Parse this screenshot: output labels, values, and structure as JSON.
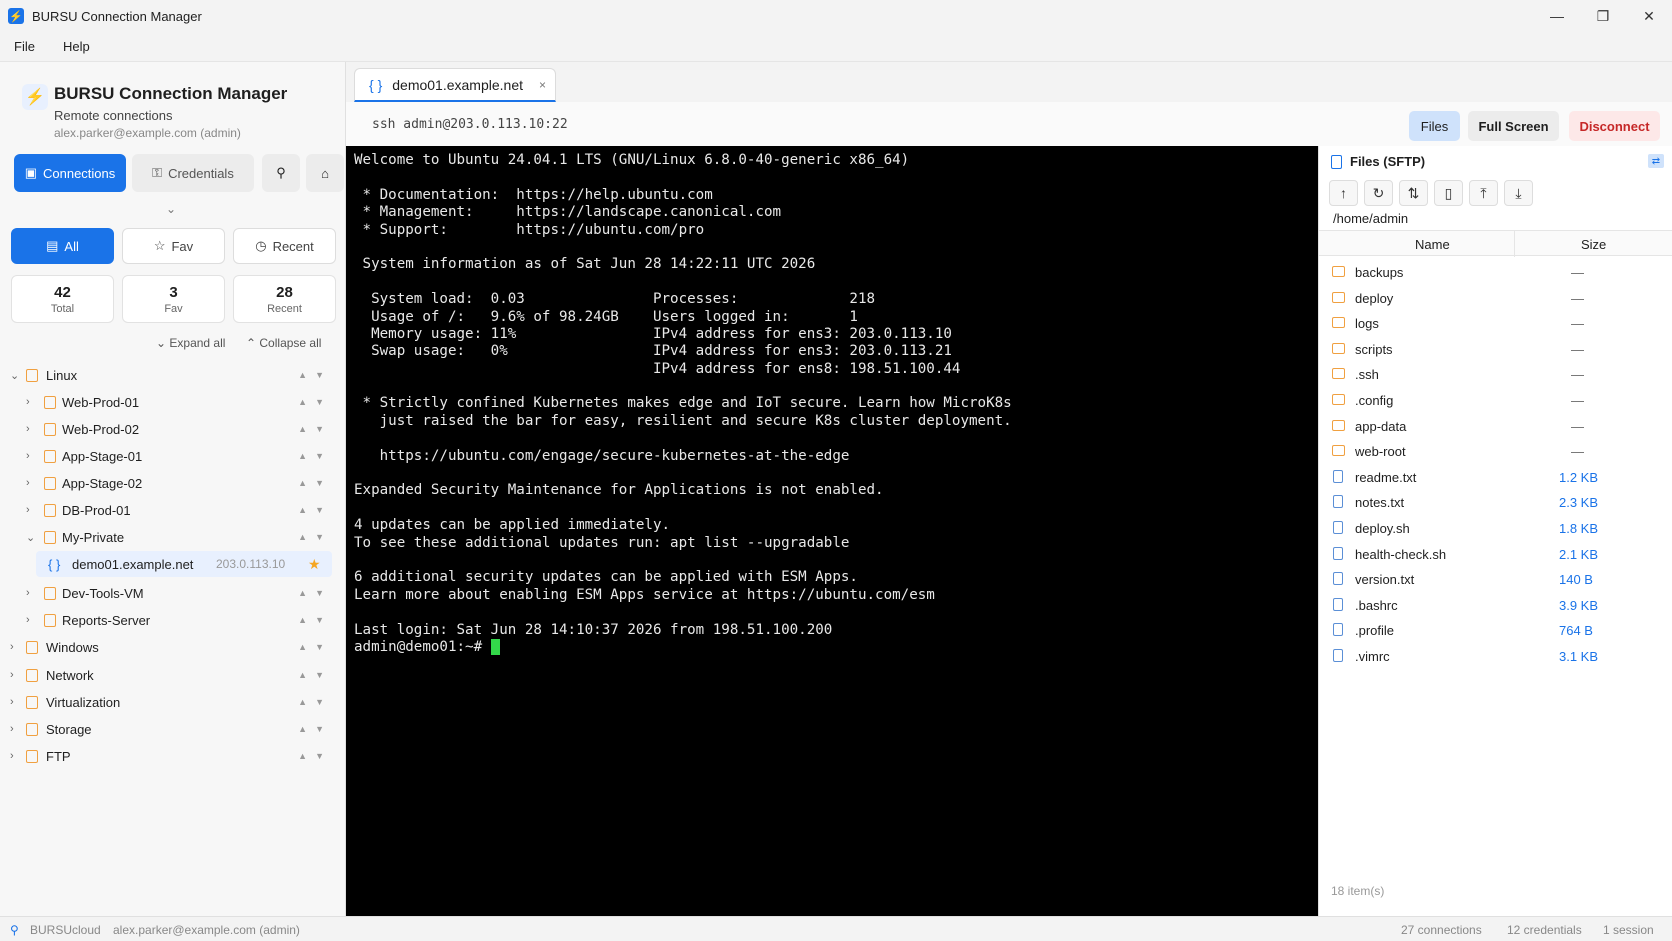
{
  "window": {
    "title": "BURSU Connection Manager",
    "min": "—",
    "max": "❐",
    "close": "✕",
    "logo": "⚡"
  },
  "menu": [
    "File",
    "Help"
  ],
  "sidebar": {
    "brand": {
      "name": "BURSU Connection Manager",
      "subtitle": "Remote connections",
      "user": "alex.parker@example.com (admin)",
      "icon": "⚡"
    },
    "nav": {
      "connections": "Connections",
      "credentials": "Credentials"
    },
    "filters": {
      "all": "All",
      "fav": "Fav",
      "recent": "Recent"
    },
    "stats": [
      {
        "value": "42",
        "label": "Total"
      },
      {
        "value": "3",
        "label": "Fav"
      },
      {
        "value": "28",
        "label": "Recent"
      }
    ],
    "expand_all": "Expand all",
    "collapse_all": "Collapse all",
    "tree": [
      {
        "label": "Linux",
        "level": 0,
        "expanded": true
      },
      {
        "label": "Web-Prod-01",
        "level": 1,
        "expanded": false
      },
      {
        "label": "Web-Prod-02",
        "level": 1,
        "expanded": false
      },
      {
        "label": "App-Stage-01",
        "level": 1,
        "expanded": false
      },
      {
        "label": "App-Stage-02",
        "level": 1,
        "expanded": false
      },
      {
        "label": "DB-Prod-01",
        "level": 1,
        "expanded": false
      },
      {
        "label": "My-Private",
        "level": 1,
        "expanded": true
      },
      {
        "label": "demo01.example.net",
        "level": 2,
        "selected": true,
        "ip": "203.0.113.10"
      },
      {
        "label": "Dev-Tools-VM",
        "level": 1,
        "expanded": false
      },
      {
        "label": "Reports-Server",
        "level": 1,
        "expanded": false
      },
      {
        "label": "Windows",
        "level": 0,
        "expanded": false
      },
      {
        "label": "Network",
        "level": 0,
        "expanded": false
      },
      {
        "label": "Virtualization",
        "level": 0,
        "expanded": false
      },
      {
        "label": "Storage",
        "level": 0,
        "expanded": false
      },
      {
        "label": "FTP",
        "level": 0,
        "expanded": false
      }
    ]
  },
  "tab": {
    "label": "demo01.example.net",
    "icon": "{ }",
    "close": "×"
  },
  "toolbar": {
    "ssh": "ssh  admin@203.0.113.10:22",
    "files": "Files",
    "full_screen": "Full Screen",
    "disconnect": "Disconnect"
  },
  "terminal": {
    "lines": [
      "Welcome to Ubuntu 24.04.1 LTS (GNU/Linux 6.8.0-40-generic x86_64)",
      "",
      " * Documentation:  https://help.ubuntu.com",
      " * Management:     https://landscape.canonical.com",
      " * Support:        https://ubuntu.com/pro",
      "",
      " System information as of Sat Jun 28 14:22:11 UTC 2026",
      "",
      "  System load:  0.03               Processes:             218",
      "  Usage of /:   9.6% of 98.24GB    Users logged in:       1",
      "  Memory usage: 11%                IPv4 address for ens3: 203.0.113.10",
      "  Swap usage:   0%                 IPv4 address for ens3: 203.0.113.21",
      "                                   IPv4 address for ens8: 198.51.100.44",
      "",
      " * Strictly confined Kubernetes makes edge and IoT secure. Learn how MicroK8s",
      "   just raised the bar for easy, resilient and secure K8s cluster deployment.",
      "",
      "   https://ubuntu.com/engage/secure-kubernetes-at-the-edge",
      "",
      "Expanded Security Maintenance for Applications is not enabled.",
      "",
      "4 updates can be applied immediately.",
      "To see these additional updates run: apt list --upgradable",
      "",
      "6 additional security updates can be applied with ESM Apps.",
      "Learn more about enabling ESM Apps service at https://ubuntu.com/esm",
      "",
      "Last login: Sat Jun 28 14:10:37 2026 from 198.51.100.200"
    ],
    "prompt": "admin@demo01:~# "
  },
  "files": {
    "title": "Files (SFTP)",
    "path": "/home/admin",
    "col_name": "Name",
    "col_size": "Size",
    "tools": [
      "↑",
      "↻",
      "⇅",
      "▯",
      "⤒",
      "⤓"
    ],
    "items": [
      {
        "name": "backups",
        "type": "folder",
        "size": "—"
      },
      {
        "name": "deploy",
        "type": "folder",
        "size": "—"
      },
      {
        "name": "logs",
        "type": "folder",
        "size": "—"
      },
      {
        "name": "scripts",
        "type": "folder",
        "size": "—"
      },
      {
        "name": ".ssh",
        "type": "folder",
        "size": "—"
      },
      {
        "name": ".config",
        "type": "folder",
        "size": "—"
      },
      {
        "name": "app-data",
        "type": "folder",
        "size": "—"
      },
      {
        "name": "web-root",
        "type": "folder",
        "size": "—"
      },
      {
        "name": "readme.txt",
        "type": "file",
        "size": "1.2 KB"
      },
      {
        "name": "notes.txt",
        "type": "file",
        "size": "2.3 KB"
      },
      {
        "name": "deploy.sh",
        "type": "file",
        "size": "1.8 KB"
      },
      {
        "name": "health-check.sh",
        "type": "file",
        "size": "2.1 KB"
      },
      {
        "name": "version.txt",
        "type": "file",
        "size": "140 B"
      },
      {
        "name": ".bashrc",
        "type": "file",
        "size": "3.9 KB"
      },
      {
        "name": ".profile",
        "type": "file",
        "size": "764 B"
      },
      {
        "name": ".vimrc",
        "type": "file",
        "size": "3.1 KB"
      }
    ],
    "count": "18 item(s)"
  },
  "statusbar": {
    "cloud": "BURSUcloud",
    "user": "alex.parker@example.com (admin)",
    "connections": "27 connections",
    "credentials": "12 credentials",
    "sessions": "1 session"
  },
  "colors": {
    "accent": "#1a73e8",
    "folder": "#f0a040",
    "danger": "#c62828",
    "cursor": "#33d84a"
  }
}
